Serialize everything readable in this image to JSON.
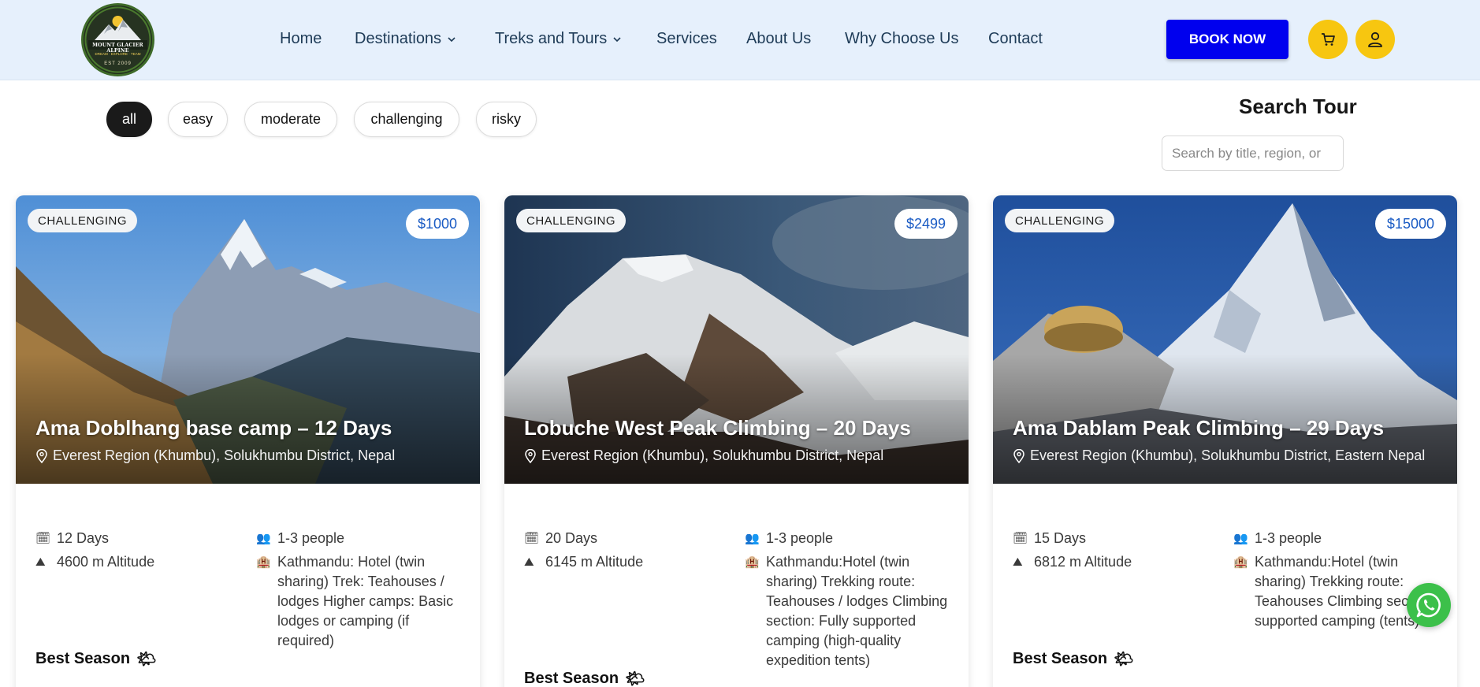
{
  "brand": {
    "logo_name": "MOUNT GLACIER ALPINE",
    "logo_tagline": "DREAM · EXPLORE · TEAM",
    "logo_est": "EST 2009"
  },
  "nav": {
    "items": [
      {
        "label": "Home"
      },
      {
        "label": "Destinations"
      },
      {
        "label": "Treks and Tours"
      },
      {
        "label": "Services"
      },
      {
        "label": "About Us"
      },
      {
        "label": "Why Choose Us"
      },
      {
        "label": "Contact"
      }
    ],
    "book_label": "BOOK NOW"
  },
  "filters": [
    "all",
    "easy",
    "moderate",
    "challenging",
    "risky"
  ],
  "active_filter": "all",
  "search": {
    "title": "Search Tour",
    "placeholder": "Search by title, region, or"
  },
  "cards": [
    {
      "difficulty": "CHALLENGING",
      "price": "$1000",
      "title": "Ama Doblhang base camp – 12 Days",
      "location": "Everest Region (Khumbu), Solukhumbu District, Nepal",
      "duration": "12 Days",
      "altitude": "4600 m Altitude",
      "group": "1-3 people",
      "accommodation": "Kathmandu: Hotel (twin sharing) Trek: Teahouses / lodges Higher camps: Basic lodges or camping (if required)",
      "best_season_label": "Best Season"
    },
    {
      "difficulty": "CHALLENGING",
      "price": "$2499",
      "title": "Lobuche West Peak Climbing – 20 Days",
      "location": "Everest Region (Khumbu), Solukhumbu District, Nepal",
      "duration": "20 Days",
      "altitude": "6145 m Altitude",
      "group": "1-3 people",
      "accommodation": "Kathmandu:Hotel (twin sharing) Trekking route: Teahouses / lodges Climbing section: Fully supported camping (high-quality expedition tents)",
      "best_season_label": "Best Season"
    },
    {
      "difficulty": "CHALLENGING",
      "price": "$15000",
      "title": "Ama Dablam Peak Climbing – 29 Days",
      "location": "Everest Region (Khumbu), Solukhumbu District, Eastern Nepal",
      "duration": "15 Days",
      "altitude": "6812 m Altitude",
      "group": "1-3 people",
      "accommodation": "Kathmandu:Hotel (twin sharing) Trekking route: Teahouses Climbing section: supported camping (tents)",
      "best_season_label": "Best Season"
    }
  ],
  "colors": {
    "header_bg": "#e6f0fc",
    "book_button": "#0000ee",
    "accent_yellow": "#f7c610",
    "price_text": "#1a5bc4",
    "whatsapp": "#3cc04a"
  },
  "icons": {
    "cart": "cart-icon",
    "user": "user-icon",
    "calendar": "calendar-icon",
    "mountain": "altitude-icon",
    "people": "people-icon",
    "hotel": "hotel-icon",
    "location": "location-pin-icon",
    "sun": "sun-cloud-icon",
    "whatsapp": "whatsapp-icon"
  }
}
